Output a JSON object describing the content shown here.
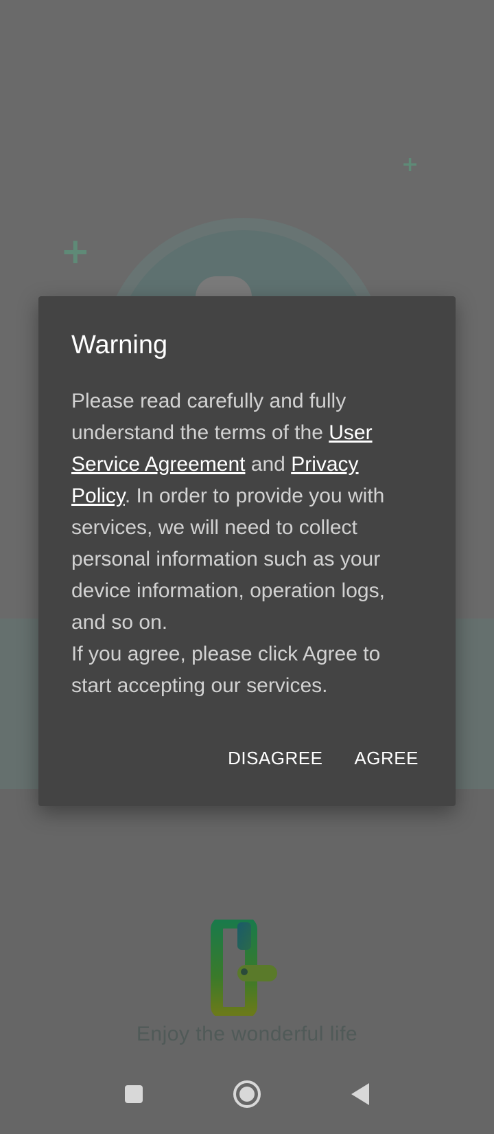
{
  "background": {
    "tagline": "Enjoy the wonderful life"
  },
  "dialog": {
    "title": "Warning",
    "body": {
      "part1": "Please read carefully and fully understand the terms of the ",
      "link_agreement": "User Service Agreement",
      "part2": " and ",
      "link_privacy": "Privacy Policy",
      "part3": ". In order to provide you with services, we will need to collect personal information such as your device information, operation logs, and so on.",
      "part4": " If you agree, please click Agree to start accepting our services."
    },
    "buttons": {
      "disagree": "DISAGREE",
      "agree": "AGREE"
    }
  },
  "navbar": {
    "icons": [
      "recent-apps-icon",
      "home-icon",
      "back-icon"
    ]
  },
  "colors": {
    "scrim": "#666666",
    "dialog_bg": "#444444",
    "title": "#ffffff",
    "body_text": "#d2d2d2",
    "accent_green": "#2e9a46",
    "accent_teal": "#1a7aa0"
  }
}
